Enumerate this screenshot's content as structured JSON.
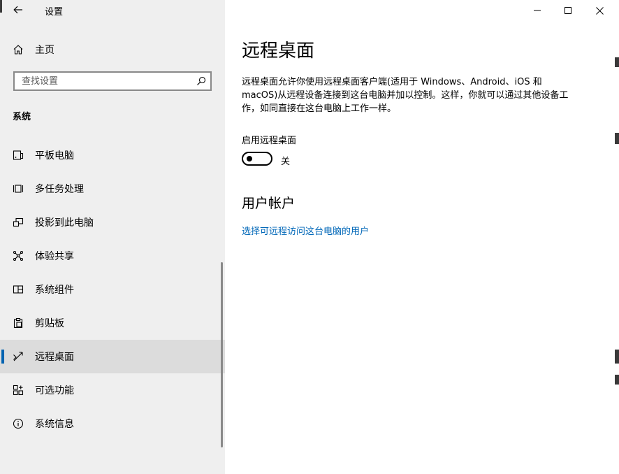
{
  "app": {
    "title": "设置"
  },
  "sidebar": {
    "home_label": "主页",
    "search_placeholder": "查找设置",
    "section_title": "系统",
    "items": [
      {
        "label": "平板电脑",
        "icon": "tablet-icon"
      },
      {
        "label": "多任务处理",
        "icon": "multitask-icon"
      },
      {
        "label": "投影到此电脑",
        "icon": "project-icon"
      },
      {
        "label": "体验共享",
        "icon": "share-icon"
      },
      {
        "label": "系统组件",
        "icon": "components-icon"
      },
      {
        "label": "剪贴板",
        "icon": "clipboard-icon"
      },
      {
        "label": "远程桌面",
        "icon": "remote-desktop-icon",
        "selected": true
      },
      {
        "label": "可选功能",
        "icon": "optional-features-icon"
      },
      {
        "label": "系统信息",
        "icon": "info-icon"
      }
    ]
  },
  "content": {
    "title": "远程桌面",
    "description": "远程桌面允许你使用远程桌面客户端(适用于 Windows、Android、iOS 和 macOS)从远程设备连接到这台电脑并加以控制。这样，你就可以通过其他设备工作，如同直接在这台电脑上工作一样。",
    "toggle_label": "启用远程桌面",
    "toggle_state": "关",
    "toggle_on": false,
    "user_section_title": "用户帐户",
    "user_link": "选择可远程访问这台电脑的用户"
  },
  "colors": {
    "accent": "#0063b1",
    "link": "#0067b8",
    "sidebar_bg": "#efefef",
    "selected_bg": "#dcdcdc"
  }
}
